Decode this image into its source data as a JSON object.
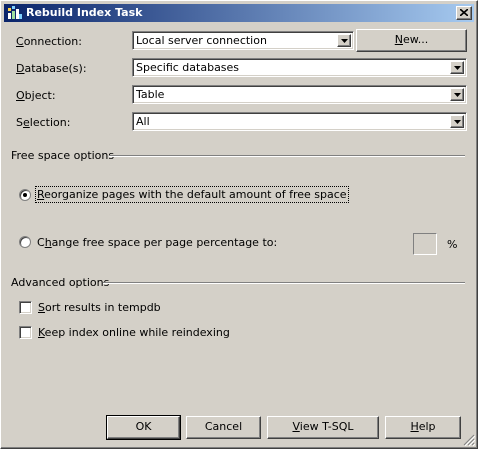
{
  "window": {
    "title": "Rebuild Index Task",
    "close_label": "×"
  },
  "form": {
    "connection": {
      "label": "Connection:",
      "value": "Local server connection",
      "new_button": "New..."
    },
    "databases": {
      "label": "Database(s):",
      "value": "Specific databases"
    },
    "object": {
      "label": "Object:",
      "value": "Table"
    },
    "selection": {
      "label": "Selection:",
      "value": "All"
    }
  },
  "free_space": {
    "group_label": "Free space options",
    "option_default": "Reorganize pages with the default amount of free space",
    "option_change": "Change free space per page percentage to:",
    "percent_value": "",
    "percent_sign": "%",
    "selected": "default"
  },
  "advanced": {
    "group_label": "Advanced options",
    "sort_tempdb": {
      "label": "Sort results in tempdb",
      "checked": false
    },
    "keep_online": {
      "label": "Keep index online while reindexing",
      "checked": false
    }
  },
  "buttons": {
    "ok": "OK",
    "cancel": "Cancel",
    "view_tsql": "View T-SQL",
    "help": "Help"
  },
  "icons": {
    "title": "task-icon",
    "dropdown": "chevron-down-icon",
    "close": "close-icon",
    "grip": "resize-grip-icon"
  }
}
